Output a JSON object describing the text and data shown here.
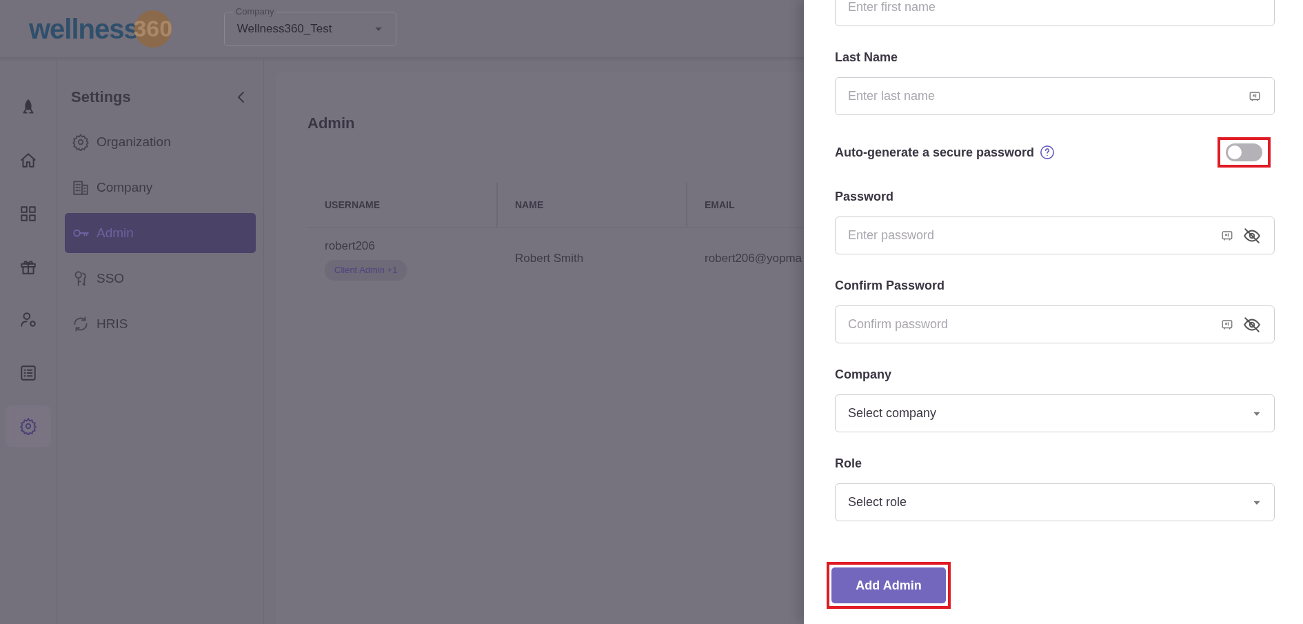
{
  "header": {
    "logo": {
      "word": "wellness",
      "number": "360"
    },
    "company_select": {
      "label": "Company",
      "value": "Wellness360_Test"
    }
  },
  "rail": [
    {
      "selected": false
    },
    {
      "selected": false
    },
    {
      "selected": false
    },
    {
      "selected": false
    },
    {
      "selected": false
    },
    {
      "selected": false
    },
    {
      "selected": true
    }
  ],
  "settings": {
    "title": "Settings",
    "items": [
      {
        "label": "Organization",
        "selected": false
      },
      {
        "label": "Company",
        "selected": false
      },
      {
        "label": "Admin",
        "selected": true
      },
      {
        "label": "SSO",
        "selected": false
      },
      {
        "label": "HRIS",
        "selected": false
      }
    ]
  },
  "page": {
    "title": "Admin",
    "table": {
      "columns": [
        "USERNAME",
        "NAME",
        "EMAIL"
      ],
      "rows": [
        {
          "username": "robert206",
          "role_badge": "Client Admin +1",
          "name": "Robert Smith",
          "email": "robert206@yopma"
        }
      ]
    }
  },
  "drawer": {
    "fields": [
      {
        "kind": "text",
        "placeholder": "Enter first name"
      },
      {
        "kind": "text",
        "label": "Last Name",
        "placeholder": "Enter last name",
        "autofill": true
      },
      {
        "kind": "toggle",
        "label": "Auto-generate a secure password",
        "on": false,
        "highlighted": true
      },
      {
        "kind": "password",
        "label": "Password",
        "placeholder": "Enter password"
      },
      {
        "kind": "password",
        "label": "Confirm Password",
        "placeholder": "Confirm password"
      },
      {
        "kind": "select",
        "label": "Company",
        "value": "Select company"
      },
      {
        "kind": "select",
        "label": "Role",
        "value": "Select role"
      }
    ],
    "submit": {
      "label": "Add Admin",
      "highlighted": true
    }
  }
}
